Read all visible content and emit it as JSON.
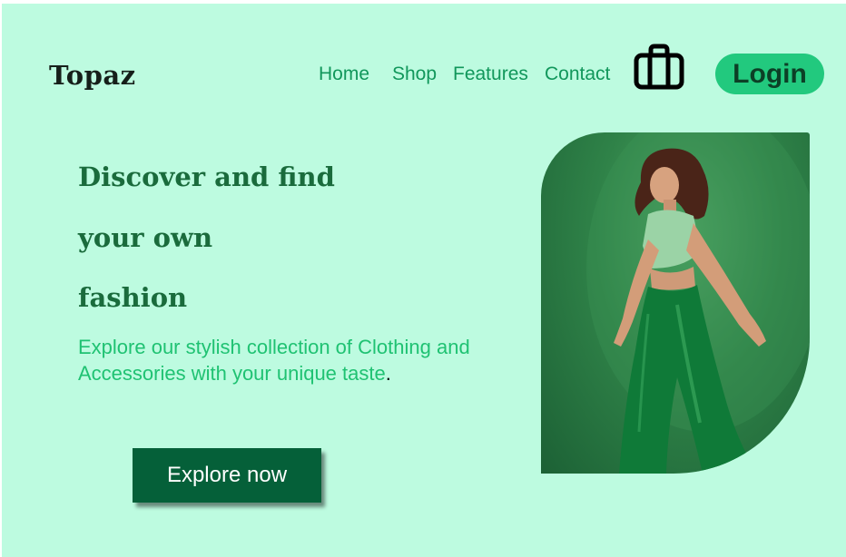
{
  "header": {
    "logo": "Topaz",
    "nav": [
      "Home",
      "Shop",
      "Features",
      "Contact"
    ],
    "cart_icon": "shopping-bag-icon",
    "login_label": "Login"
  },
  "hero": {
    "headline": [
      "Discover and find",
      "your own",
      "fashion"
    ],
    "description": "Explore our stylish collection of Clothing and Accessories with your unique taste",
    "description_end": ".",
    "cta_label": "Explore now",
    "image": "model-in-green-outfit"
  },
  "colors": {
    "background": "#bdfbe0",
    "nav_text": "#11975b",
    "login_bg": "#22c97e",
    "headline": "#1a6b3c",
    "description": "#1fc272",
    "cta_bg": "#056039",
    "image_bg": "#2f8248"
  }
}
